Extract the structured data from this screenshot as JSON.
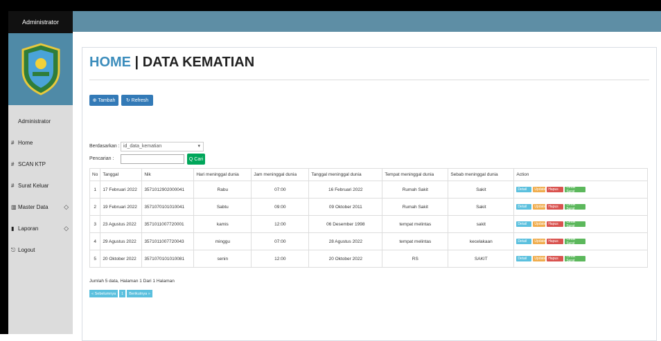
{
  "sidebar": {
    "brand": "Administrator",
    "items": [
      {
        "icon": "",
        "label": "Administrator",
        "chev": ""
      },
      {
        "icon": "#",
        "label": "Home",
        "chev": ""
      },
      {
        "icon": "#",
        "label": "SCAN KTP",
        "chev": ""
      },
      {
        "icon": "#",
        "label": "Surat Keluar",
        "chev": ""
      },
      {
        "icon": "▥",
        "label": "Master Data",
        "chev": "◇"
      },
      {
        "icon": "▮",
        "label": "Laporan",
        "chev": "◇"
      },
      {
        "icon": "⎋",
        "label": "Logout",
        "chev": ""
      }
    ]
  },
  "page": {
    "title_home": "HOME",
    "title_rest": " | DATA KEMATIAN",
    "btn_tambah": "Tambah",
    "btn_refresh": "Refresh",
    "label_berdasarkan": "Berdasarkan :",
    "select_value": "id_data_kematian",
    "label_pencarian": "Pencarian :",
    "btn_cari": "Q Cari"
  },
  "table": {
    "headers": [
      "No",
      "Tanggal",
      "Nik",
      "Hari meninggal dunia",
      "Jam meninggal dunia",
      "Tanggal meninggal dunia",
      "Tempat meninggal dunia",
      "Sebab meninggal dunia",
      "Action"
    ],
    "rows": [
      [
        "1",
        "17 Februari 2022",
        "3571012902000041",
        "Rabu",
        "07:00",
        "16 Februari 2022",
        "Rumah Sakit",
        "Sakit"
      ],
      [
        "2",
        "19 Februari 2022",
        "3571070101010041",
        "Sabtu",
        "09:00",
        "09 Oktober 2011",
        "Rumah Sakit",
        "Sakit"
      ],
      [
        "3",
        "23 Agustus 2022",
        "3571011007720001",
        "kamis",
        "12:00",
        "06 Desember 1998",
        "tempat melintas",
        "sakit"
      ],
      [
        "4",
        "29 Agustus 2022",
        "3571011007720043",
        "minggu",
        "07:00",
        "28 Agustus 2022",
        "tempat melintas",
        "kecelakaan"
      ],
      [
        "5",
        "20 Oktober 2022",
        "3571070101010081",
        "senin",
        "12:00",
        "20 Oktober 2022",
        "RS",
        "SAKIT"
      ]
    ],
    "actions": {
      "detail": "Detail",
      "update": "Update",
      "hapus": "Hapus",
      "cetak": "Cetak Surat"
    }
  },
  "footer": {
    "info": "Jumlah 5 data, Halaman 1 Dari 1 Halaman",
    "prev": "« Sebelumnya",
    "page": "1",
    "next": "Berikutnya »"
  }
}
